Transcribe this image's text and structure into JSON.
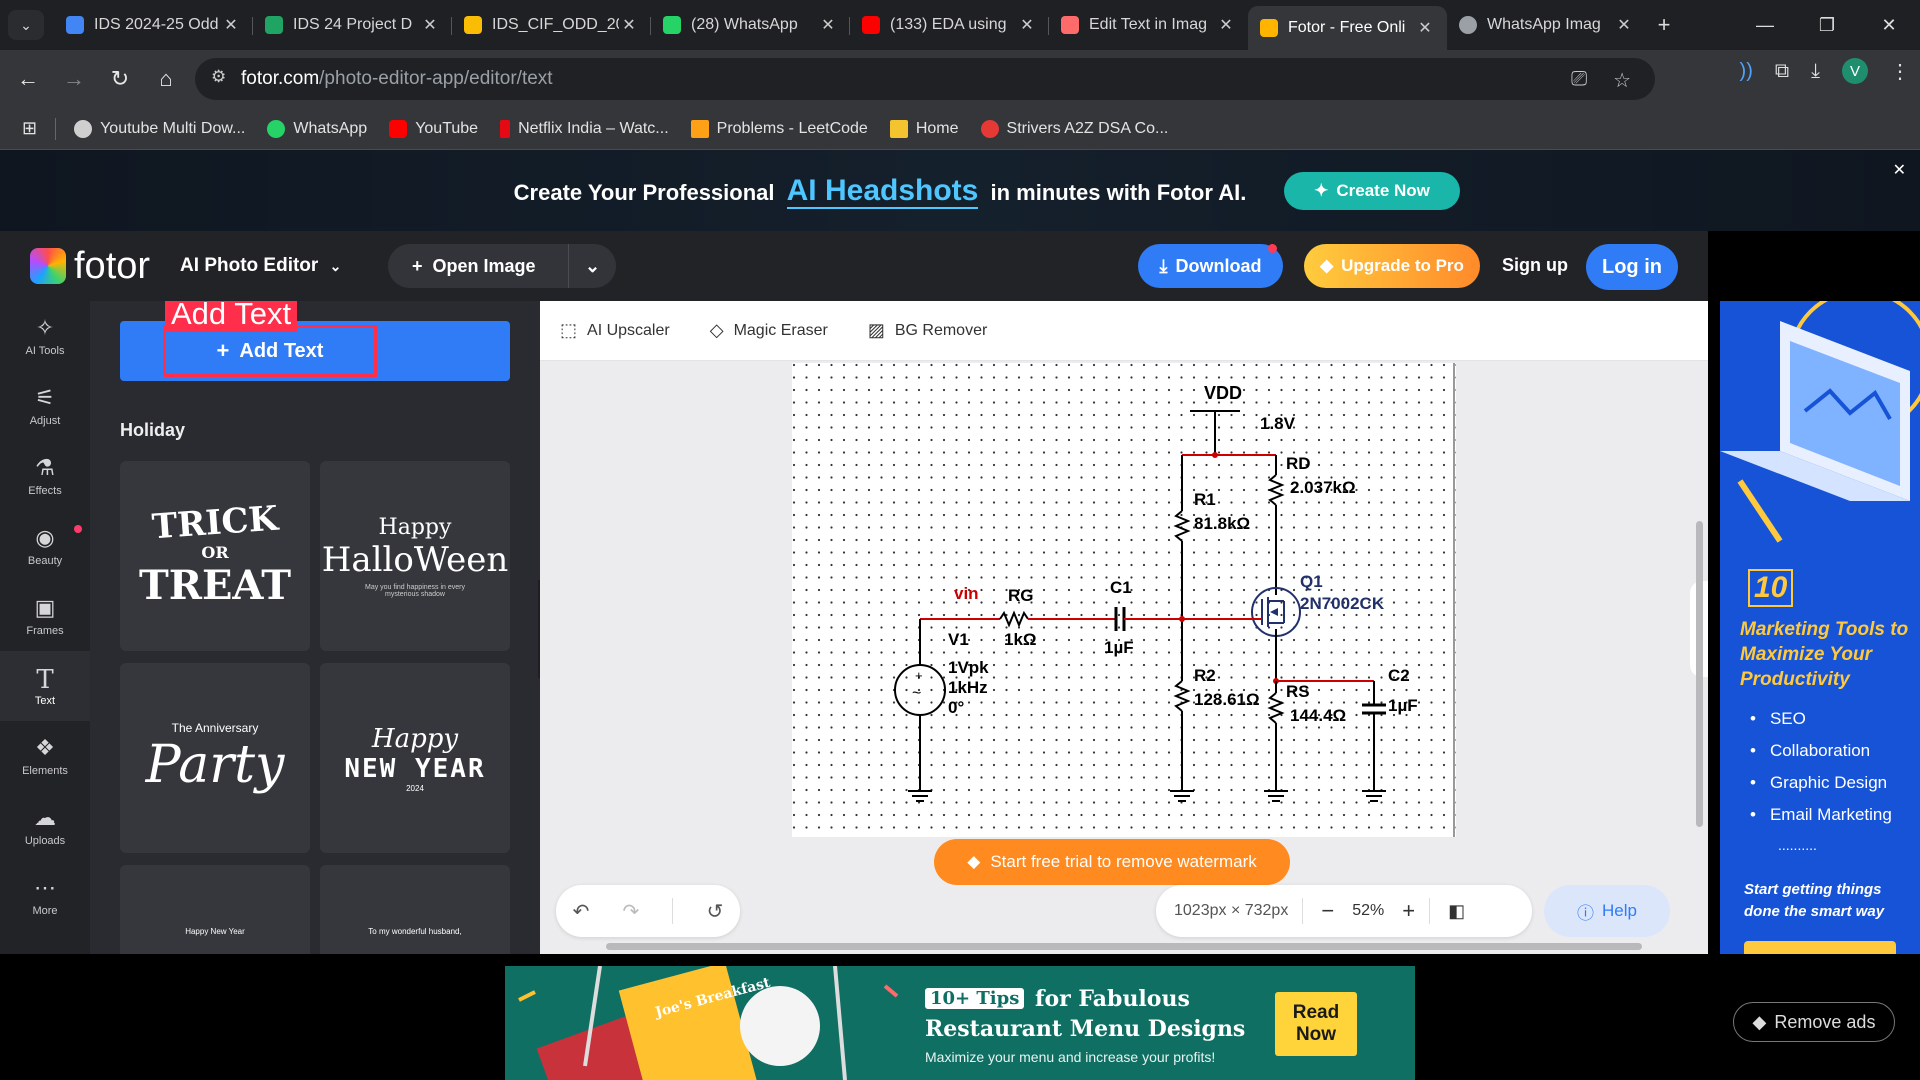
{
  "browser": {
    "tabs": [
      {
        "title": "IDS 2024-25 Odd",
        "color": "#4285f4"
      },
      {
        "title": "IDS 24 Project D",
        "color": "#1fa463"
      },
      {
        "title": "IDS_CIF_ODD_20",
        "color": "#fbbc04"
      },
      {
        "title": "(28) WhatsApp",
        "color": "#25d366"
      },
      {
        "title": "(133) EDA using",
        "color": "#ff0000"
      },
      {
        "title": "Edit Text in Imag",
        "color": "#ff6b6b"
      },
      {
        "title": "Fotor - Free Onli",
        "color": "#ffb400"
      },
      {
        "title": "WhatsApp Imag",
        "color": "#9aa0a6"
      }
    ],
    "url_host": "fotor.com",
    "url_path": "/photo-editor-app/editor/text",
    "avatar_letter": "V",
    "bookmarks": [
      {
        "label": "Youtube Multi Dow...",
        "color": "#cfcfcf"
      },
      {
        "label": "WhatsApp",
        "color": "#25d366"
      },
      {
        "label": "YouTube",
        "color": "#ff0000"
      },
      {
        "label": "Netflix India – Watc...",
        "color": "#e50914"
      },
      {
        "label": "Problems - LeetCode",
        "color": "#ffa116"
      },
      {
        "label": "Home",
        "color": "#f4c430"
      },
      {
        "label": "Strivers A2Z DSA Co...",
        "color": "#e53935"
      }
    ]
  },
  "promo": {
    "prefix": "Create Your Professional",
    "highlight": "AI Headshots",
    "suffix": "in minutes with Fotor AI.",
    "cta": "Create Now"
  },
  "header": {
    "logo": "fotor",
    "editor_menu": "AI Photo Editor",
    "open_image": "Open Image",
    "download": "Download",
    "upgrade": "Upgrade to Pro",
    "signup": "Sign up",
    "login": "Log in"
  },
  "sidebar": {
    "items": [
      {
        "label": "AI Tools",
        "icon": "✧"
      },
      {
        "label": "Adjust",
        "icon": "⚟"
      },
      {
        "label": "Effects",
        "icon": "⚗"
      },
      {
        "label": "Beauty",
        "icon": "◉"
      },
      {
        "label": "Frames",
        "icon": "▣"
      },
      {
        "label": "Text",
        "icon": "T"
      },
      {
        "label": "Elements",
        "icon": "❖"
      },
      {
        "label": "Uploads",
        "icon": "☁"
      },
      {
        "label": "More",
        "icon": "⋯"
      }
    ]
  },
  "panel": {
    "tag": "Add Text",
    "add_text": "Add Text",
    "section": "Holiday",
    "templates": [
      {
        "line1": "TRICK",
        "line2": "OR",
        "line3": "TREAT"
      },
      {
        "line1": "Happy",
        "line2": "HalloWeen",
        "line3": "May you find happiness in every mysterious shadow"
      },
      {
        "line1": "The Anniversary",
        "line2": "Party",
        "line3": ""
      },
      {
        "line1": "Happy",
        "line2": "NEW YEAR",
        "line3": "2024"
      },
      {
        "line1": "Happy New Year",
        "line2": "",
        "line3": ""
      },
      {
        "line1": "To my wonderful husband,",
        "line2": "",
        "line3": ""
      }
    ]
  },
  "canvas": {
    "tools": [
      "AI Upscaler",
      "Magic Eraser",
      "BG Remover"
    ],
    "watermark": "Start free trial to remove watermark",
    "dimensions": "1023px × 732px",
    "zoom": "52%",
    "help": "Help",
    "circuit": {
      "vdd": "VDD",
      "vdd_val": "1.8V",
      "rd": "RD",
      "rd_val": "2.037kΩ",
      "r1": "R1",
      "r1_val": "81.8kΩ",
      "q1": "Q1",
      "q1_val": "2N7002CK",
      "vin": "vin",
      "rg": "RG",
      "rg_val": "1kΩ",
      "c1": "C1",
      "c1_val": "1µF",
      "v1": "V1",
      "v1_amp": "1Vpk",
      "v1_freq": "1kHz",
      "v1_phase": "0°",
      "r2": "R2",
      "r2_val": "128.61Ω",
      "rs": "RS",
      "rs_val": "144.4Ω",
      "c2": "C2",
      "c2_val": "1µF"
    }
  },
  "right_ad": {
    "number": "10",
    "headline": "Marketing Tools to Maximize Your Productivity",
    "bullets": [
      "SEO",
      "Collaboration",
      "Graphic Design",
      "Email Marketing"
    ],
    "more": "..........",
    "cta": "Start getting things done the smart way"
  },
  "bottom_ad": {
    "badge": "10+ Tips",
    "line1": "for Fabulous",
    "line2": "Restaurant Menu Designs",
    "line3": "Maximize your menu and increase your profits!",
    "menu_title": "Joe's Breakfast",
    "read": "Read Now",
    "remove_ads": "Remove ads"
  }
}
